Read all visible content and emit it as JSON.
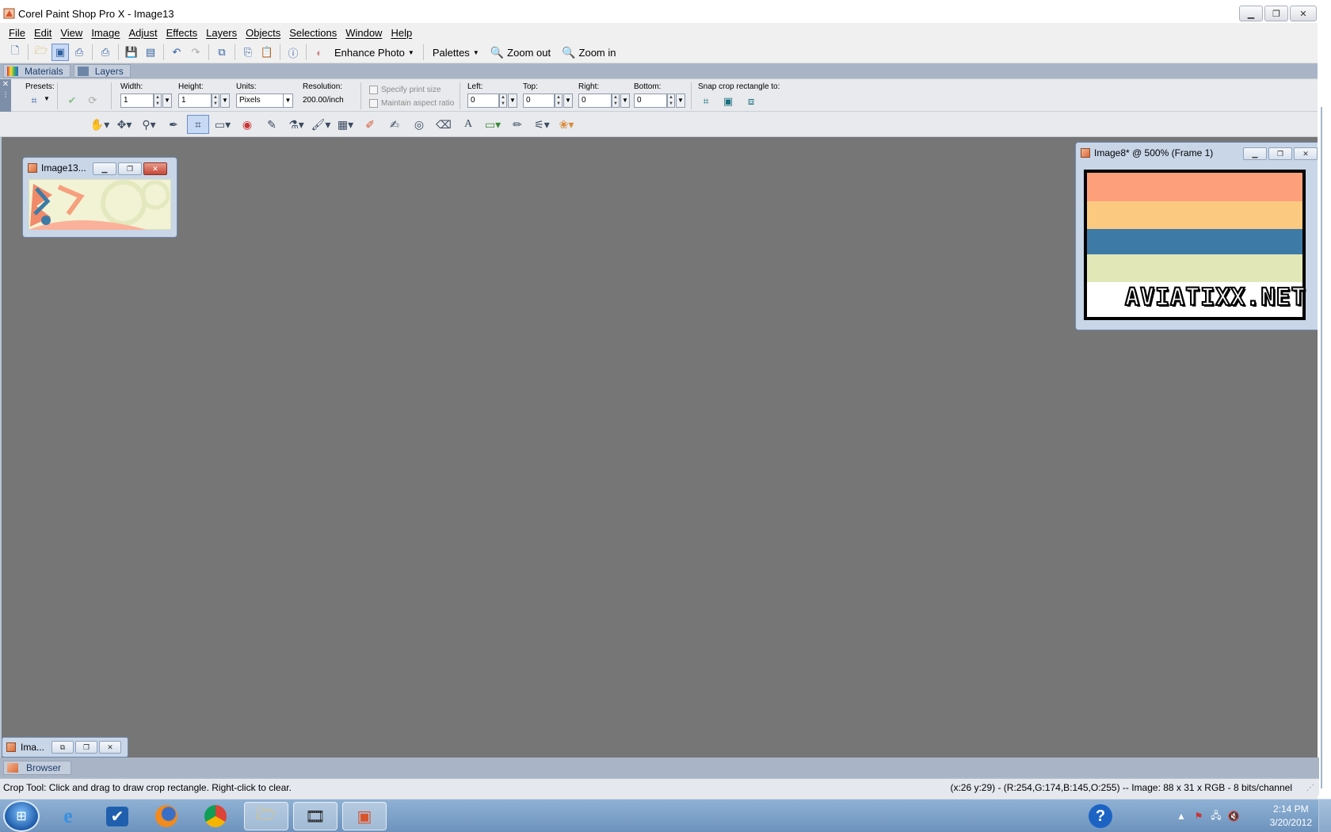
{
  "window": {
    "title": "Corel Paint Shop Pro X - Image13"
  },
  "menu": [
    "File",
    "Edit",
    "View",
    "Image",
    "Adjust",
    "Effects",
    "Layers",
    "Objects",
    "Selections",
    "Window",
    "Help"
  ],
  "toolbar": {
    "enhance_photo": "Enhance Photo",
    "palettes": "Palettes",
    "zoom_out": "Zoom out",
    "zoom_in": "Zoom in"
  },
  "palette_tabs": {
    "materials": "Materials",
    "layers": "Layers"
  },
  "crop_options": {
    "presets_label": "Presets:",
    "width_label": "Width:",
    "width_value": "1",
    "height_label": "Height:",
    "height_value": "1",
    "units_label": "Units:",
    "units_value": "Pixels",
    "resolution_label": "Resolution:",
    "resolution_value": "200.00/inch",
    "specify_print_size": "Specify print size",
    "maintain_aspect": "Maintain aspect ratio",
    "left_label": "Left:",
    "left_value": "0",
    "top_label": "Top:",
    "top_value": "0",
    "right_label": "Right:",
    "right_value": "0",
    "bottom_label": "Bottom:",
    "bottom_value": "0",
    "snap_label": "Snap crop rectangle to:"
  },
  "doc_image13": {
    "title": "Image13..."
  },
  "doc_image8": {
    "title": "Image8* @ 500% (Frame 1)",
    "stripe_colors": [
      "#fe9f7c",
      "#fbca80",
      "#3d7ba6",
      "#e2e7b8",
      "#ffffff"
    ],
    "logo": "AVIATIXX.NET"
  },
  "minimized_doc": {
    "title": "Ima..."
  },
  "browser_tab": {
    "label": "Browser"
  },
  "status": {
    "hint": "Crop Tool: Click and drag to draw crop rectangle. Right-click to clear.",
    "info": "(x:26 y:29) - (R:254,G:174,B:145,O:255) -- Image:  88 x 31 x RGB - 8 bits/channel"
  },
  "taskbar": {
    "time": "2:14 PM",
    "date": "3/20/2012"
  }
}
